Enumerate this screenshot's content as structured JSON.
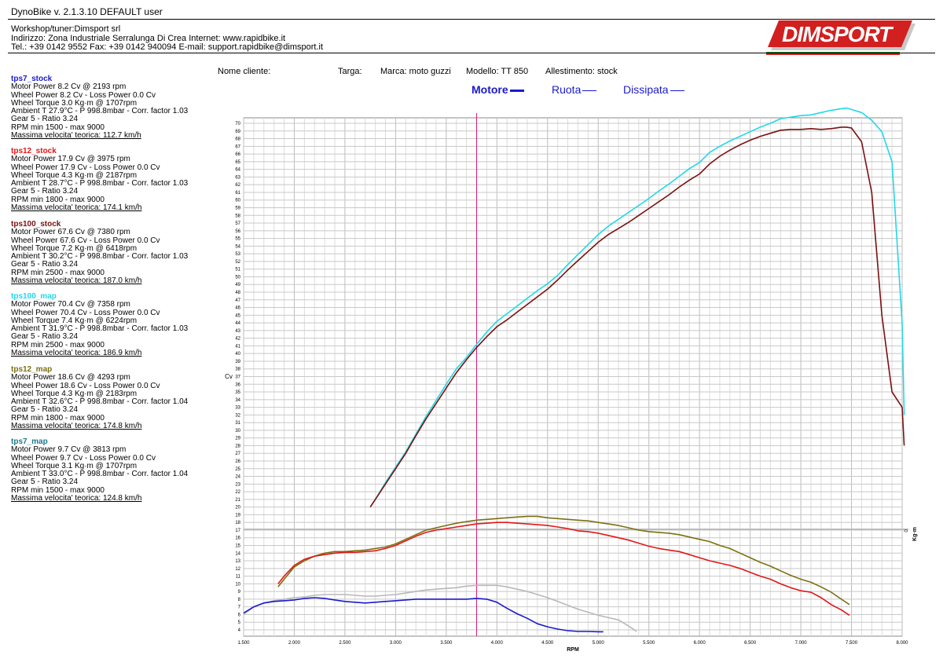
{
  "header": {
    "app_title": "DynoBike v. 2.1.3.10   DEFAULT user",
    "workshop": "Workshop/tuner:Dimsport srl",
    "address": "Indirizzo: Zona Industriale Serralunga Di Crea Internet: www.rapidbike.it",
    "contacts": "Tel.: +39 0142 9552 Fax: +39 0142 940094 E-mail: support.rapidbike@dimsport.it",
    "logo_text": "DIMSPORT"
  },
  "vehicle": {
    "client": "Nome cliente:",
    "plate": "Targa:",
    "brand": "Marca: moto guzzi",
    "model": "Modello: TT 850",
    "trim": "Allestimento: stock"
  },
  "legend": {
    "motore": "Motore",
    "ruota": "Ruota",
    "dissipata": "Dissipata"
  },
  "runs": [
    {
      "name": "tps7_stock",
      "color": "#1a1acc",
      "motor": "Motor Power 8.2 Cv  @ 2193 rpm",
      "wheel": "Wheel Power 8.2 Cv  - Loss Power 0.0 Cv",
      "torque": "Wheel Torque 3.0 Kg·m  @ 1707rpm",
      "ambient": "Ambient T 27.9°C - P 998.8mbar - Corr. factor 1.03",
      "gear": "Gear 5 - Ratio 3.24",
      "rpm": "RPM min 1500 - max 9000",
      "speed": "Massima velocita' teorica: 112.7 km/h"
    },
    {
      "name": "tps12_stock",
      "color": "#e01818",
      "motor": "Motor Power 17.9 Cv  @ 3975 rpm",
      "wheel": "Wheel Power 17.9 Cv  - Loss Power 0.0 Cv",
      "torque": "Wheel Torque 4.3 Kg·m  @ 2187rpm",
      "ambient": "Ambient T 28.7°C - P 998.8mbar - Corr. factor 1.03",
      "gear": "Gear 5 - Ratio 3.24",
      "rpm": "RPM min 1800 - max 9000",
      "speed": "Massima velocita' teorica: 174.1 km/h"
    },
    {
      "name": "tps100_stock",
      "color": "#7a1010",
      "motor": "Motor Power 67.6 Cv  @ 7380 rpm",
      "wheel": "Wheel Power 67.6 Cv  - Loss Power 0.0 Cv",
      "torque": "Wheel Torque 7.2 Kg·m  @ 6418rpm",
      "ambient": "Ambient T 30.2°C - P 998.8mbar - Corr. factor 1.03",
      "gear": "Gear 5 - Ratio 3.24",
      "rpm": "RPM min 2500 - max 9000",
      "speed": "Massima velocita' teorica: 187.0 km/h"
    },
    {
      "name": "tps100_map",
      "color": "#22d8e8",
      "motor": "Motor Power 70.4 Cv  @ 7358 rpm",
      "wheel": "Wheel Power 70.4 Cv  - Loss Power 0.0 Cv",
      "torque": "Wheel Torque 7.4 Kg·m  @ 6224rpm",
      "ambient": "Ambient T 31.9°C - P 998.8mbar - Corr. factor 1.03",
      "gear": "Gear 5 - Ratio 3.24",
      "rpm": "RPM min 2500 - max 9000",
      "speed": "Massima velocita' teorica: 186.9 km/h"
    },
    {
      "name": "tps12_map",
      "color": "#7a7010",
      "motor": "Motor Power 18.6 Cv  @ 4293 rpm",
      "wheel": "Wheel Power 18.6 Cv  - Loss Power 0.0 Cv",
      "torque": "Wheel Torque 4.3 Kg·m  @ 2183rpm",
      "ambient": "Ambient T 32.6°C - P 998.8mbar - Corr. factor 1.04",
      "gear": "Gear 5 - Ratio 3.24",
      "rpm": "RPM min 1800 - max 9000",
      "speed": "Massima velocita' teorica: 174.8 km/h"
    },
    {
      "name": "tps7_map",
      "color": "#1a7a8a",
      "motor": "Motor Power 9.7 Cv  @ 3813 rpm",
      "wheel": "Wheel Power 9.7 Cv  - Loss Power 0.0 Cv",
      "torque": "Wheel Torque 3.1 Kg·m  @ 1707rpm",
      "ambient": "Ambient T 33.0°C - P 998.8mbar - Corr. factor 1.04",
      "gear": "Gear 5 - Ratio 3.24",
      "rpm": "RPM min 1500 - max 9000",
      "speed": "Massima velocita' teorica: 124.8 km/h"
    }
  ],
  "chart_data": {
    "type": "line",
    "xlabel": "RPM",
    "ylabel": "Cv",
    "y2label": "Kg·m",
    "y2_tick": "0",
    "xlim": [
      1500,
      8000
    ],
    "ylim": [
      3,
      71
    ],
    "x_ticks": [
      1500,
      2000,
      2500,
      3000,
      3500,
      4000,
      4500,
      5000,
      5500,
      6000,
      6500,
      7000,
      7500,
      8000
    ],
    "x_tick_labels": [
      "1.500",
      "2.000",
      "2.500",
      "3.000",
      "3.500",
      "4.000",
      "4.500",
      "5.000",
      "5.500",
      "6.000",
      "6.500",
      "7.000",
      "7.500",
      "8.000"
    ],
    "y_ticks_from": 4,
    "y_ticks_to": 70,
    "grid": true,
    "cursor_rpm": 3800,
    "series": [
      {
        "name": "tps100_map",
        "color": "#22d8e8",
        "x": [
          2750,
          2800,
          2900,
          3000,
          3100,
          3200,
          3300,
          3400,
          3500,
          3600,
          3700,
          3800,
          3900,
          4000,
          4100,
          4200,
          4300,
          4400,
          4500,
          4600,
          4700,
          4800,
          4900,
          5000,
          5100,
          5200,
          5300,
          5400,
          5500,
          5600,
          5700,
          5800,
          5900,
          6000,
          6100,
          6200,
          6300,
          6400,
          6500,
          6600,
          6700,
          6800,
          6900,
          7000,
          7100,
          7200,
          7300,
          7400,
          7450,
          7500,
          7600,
          7700,
          7800,
          7900,
          8000,
          8020
        ],
        "y": [
          20,
          21,
          23.2,
          25.2,
          27.2,
          29.5,
          31.8,
          33.9,
          36,
          38,
          39.5,
          41.2,
          42.8,
          44.2,
          45.2,
          46.2,
          47.2,
          48.2,
          49.1,
          50.2,
          51.6,
          52.9,
          54.2,
          55.5,
          56.6,
          57.5,
          58.4,
          59.3,
          60.2,
          61.2,
          62.1,
          63.1,
          64.1,
          64.9,
          66.2,
          67,
          67.7,
          68.3,
          68.9,
          69.5,
          70,
          70.6,
          70.8,
          71,
          71.1,
          71.4,
          71.7,
          71.9,
          72,
          71.8,
          71.4,
          70.4,
          68.9,
          65,
          44,
          32
        ]
      },
      {
        "name": "tps100_stock",
        "color": "#7a1010",
        "x": [
          2750,
          2800,
          2900,
          3000,
          3100,
          3200,
          3300,
          3400,
          3500,
          3600,
          3700,
          3800,
          3900,
          4000,
          4100,
          4200,
          4300,
          4400,
          4500,
          4600,
          4700,
          4800,
          4900,
          5000,
          5100,
          5200,
          5300,
          5400,
          5500,
          5600,
          5700,
          5800,
          5900,
          6000,
          6100,
          6200,
          6300,
          6400,
          6500,
          6600,
          6700,
          6800,
          6900,
          7000,
          7100,
          7200,
          7300,
          7400,
          7450,
          7500,
          7600,
          7700,
          7800,
          7900,
          8000,
          8020
        ],
        "y": [
          20,
          21,
          23,
          25,
          27,
          29.3,
          31.5,
          33.5,
          35.5,
          37.5,
          39.2,
          40.8,
          42.2,
          43.5,
          44.4,
          45.4,
          46.4,
          47.4,
          48.4,
          49.6,
          50.9,
          52.1,
          53.3,
          54.5,
          55.5,
          56.3,
          57.1,
          58,
          58.9,
          59.8,
          60.7,
          61.7,
          62.6,
          63.4,
          64.7,
          65.7,
          66.5,
          67.2,
          67.8,
          68.3,
          68.7,
          69.1,
          69.2,
          69.2,
          69.3,
          69.2,
          69.3,
          69.5,
          69.5,
          69.4,
          67.6,
          61,
          45,
          35,
          33,
          28
        ]
      },
      {
        "name": "tps12_map",
        "color": "#7a7010",
        "x": [
          1840,
          1900,
          2000,
          2100,
          2200,
          2300,
          2400,
          2500,
          2600,
          2700,
          2800,
          2900,
          3000,
          3100,
          3200,
          3300,
          3400,
          3500,
          3600,
          3700,
          3800,
          3900,
          4000,
          4100,
          4200,
          4300,
          4400,
          4500,
          4600,
          4700,
          4800,
          4900,
          5000,
          5100,
          5200,
          5300,
          5400,
          5500,
          5600,
          5700,
          5800,
          5900,
          6000,
          6100,
          6200,
          6300,
          6400,
          6500,
          6600,
          6700,
          6800,
          6900,
          7000,
          7100,
          7200,
          7300,
          7400,
          7480
        ],
        "y": [
          9.6,
          10.6,
          12.2,
          13.0,
          13.6,
          14.0,
          14.2,
          14.2,
          14.3,
          14.4,
          14.6,
          14.8,
          15.2,
          15.8,
          16.4,
          17.0,
          17.3,
          17.6,
          17.9,
          18.1,
          18.3,
          18.4,
          18.5,
          18.6,
          18.7,
          18.8,
          18.8,
          18.6,
          18.5,
          18.4,
          18.3,
          18.2,
          18.0,
          17.8,
          17.6,
          17.3,
          17.0,
          16.8,
          16.7,
          16.6,
          16.4,
          16.1,
          15.8,
          15.5,
          15.0,
          14.6,
          14.0,
          13.4,
          12.8,
          12.3,
          11.7,
          11.1,
          10.6,
          10.2,
          9.6,
          8.9,
          8.0,
          7.3
        ]
      },
      {
        "name": "tps12_stock",
        "color": "#e01818",
        "x": [
          1840,
          1900,
          2000,
          2100,
          2200,
          2300,
          2400,
          2500,
          2600,
          2700,
          2800,
          2900,
          3000,
          3100,
          3200,
          3300,
          3400,
          3500,
          3600,
          3700,
          3800,
          3900,
          4000,
          4100,
          4200,
          4300,
          4400,
          4500,
          4600,
          4700,
          4800,
          4900,
          5000,
          5100,
          5200,
          5300,
          5400,
          5500,
          5600,
          5700,
          5800,
          5900,
          6000,
          6100,
          6200,
          6300,
          6400,
          6500,
          6600,
          6700,
          6800,
          6900,
          7000,
          7100,
          7200,
          7300,
          7400,
          7480
        ],
        "y": [
          10.0,
          11.0,
          12.4,
          13.2,
          13.6,
          13.8,
          14.0,
          14.1,
          14.1,
          14.2,
          14.3,
          14.6,
          15.0,
          15.6,
          16.2,
          16.7,
          17.0,
          17.2,
          17.4,
          17.6,
          17.8,
          17.9,
          18.0,
          18.0,
          17.9,
          17.8,
          17.7,
          17.6,
          17.4,
          17.2,
          16.9,
          16.8,
          16.6,
          16.3,
          16.0,
          15.7,
          15.3,
          14.9,
          14.6,
          14.4,
          14.2,
          13.8,
          13.4,
          13.0,
          12.7,
          12.4,
          12.0,
          11.5,
          11.0,
          10.6,
          10.0,
          9.5,
          9.1,
          8.9,
          8.2,
          7.3,
          6.6,
          5.9
        ]
      },
      {
        "name": "tps7_map",
        "color": "#b8b8b8",
        "x": [
          1500,
          1600,
          1700,
          1800,
          1900,
          2000,
          2100,
          2200,
          2300,
          2400,
          2500,
          2600,
          2700,
          2800,
          2900,
          3000,
          3100,
          3200,
          3300,
          3400,
          3500,
          3600,
          3700,
          3800,
          3900,
          4000,
          4100,
          4200,
          4300,
          4400,
          4500,
          4600,
          4700,
          4800,
          4900,
          5000,
          5100,
          5200,
          5300,
          5380
        ],
        "y": [
          6.0,
          7.0,
          7.5,
          7.8,
          8.0,
          8.2,
          8.3,
          8.5,
          8.6,
          8.6,
          8.6,
          8.5,
          8.4,
          8.4,
          8.5,
          8.6,
          8.8,
          9.0,
          9.2,
          9.3,
          9.4,
          9.5,
          9.7,
          9.8,
          9.8,
          9.8,
          9.6,
          9.3,
          9.0,
          8.6,
          8.2,
          7.7,
          7.2,
          6.7,
          6.3,
          5.9,
          5.6,
          5.3,
          4.5,
          3.8
        ]
      },
      {
        "name": "tps7_stock",
        "color": "#1a1acc",
        "x": [
          1500,
          1600,
          1700,
          1800,
          1900,
          2000,
          2100,
          2200,
          2300,
          2400,
          2500,
          2600,
          2700,
          2800,
          2900,
          3000,
          3100,
          3200,
          3300,
          3400,
          3500,
          3600,
          3700,
          3800,
          3900,
          4000,
          4100,
          4200,
          4300,
          4400,
          4500,
          4600,
          4700,
          4800,
          4900,
          5000,
          5050
        ],
        "y": [
          6.2,
          7.0,
          7.5,
          7.7,
          7.8,
          7.9,
          8.1,
          8.2,
          8.1,
          7.9,
          7.7,
          7.6,
          7.5,
          7.6,
          7.7,
          7.8,
          7.9,
          8.0,
          8.0,
          8.0,
          8.0,
          8.0,
          8.0,
          8.1,
          8.0,
          7.6,
          6.8,
          6.1,
          5.5,
          4.8,
          4.4,
          4.1,
          3.9,
          3.8,
          3.8,
          3.75,
          3.75
        ]
      }
    ]
  }
}
